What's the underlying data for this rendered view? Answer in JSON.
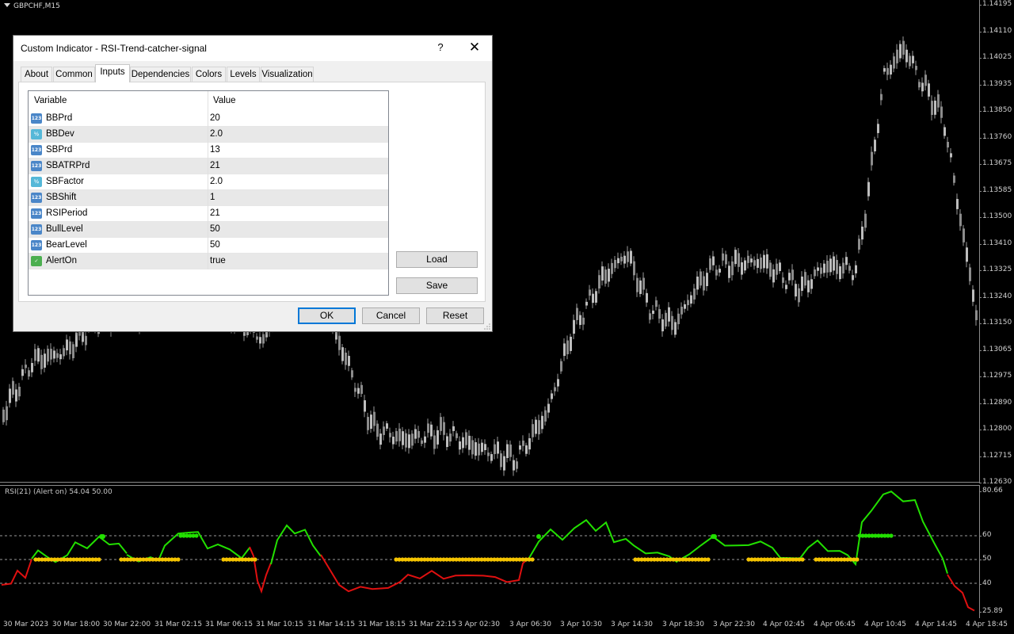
{
  "chart": {
    "symbol_label": "GBPCHF,M15",
    "rsi_label": "RSI(21) (Alert on) 54.04 50.00",
    "price_ticks": [
      "1.14195",
      "1.14110",
      "1.14025",
      "1.13935",
      "1.13850",
      "1.13760",
      "1.13675",
      "1.13585",
      "1.13500",
      "1.13410",
      "1.13325",
      "1.13240",
      "1.13150",
      "1.13065",
      "1.12975",
      "1.12890",
      "1.12800",
      "1.12715",
      "1.12630"
    ],
    "rsi_ticks": [
      "80.66",
      "60",
      "50",
      "40",
      "25.89"
    ],
    "time_ticks": [
      "30 Mar 2023",
      "30 Mar 18:00",
      "30 Mar 22:00",
      "31 Mar 02:15",
      "31 Mar 06:15",
      "31 Mar 10:15",
      "31 Mar 14:15",
      "31 Mar 18:15",
      "31 Mar 22:15",
      "3 Apr 02:30",
      "3 Apr 06:30",
      "3 Apr 10:30",
      "3 Apr 14:30",
      "3 Apr 18:30",
      "3 Apr 22:30",
      "4 Apr 02:45",
      "4 Apr 06:45",
      "4 Apr 10:45",
      "4 Apr 14:45",
      "4 Apr 18:45"
    ],
    "colors": {
      "bull": "#22e000",
      "bear": "#e01010",
      "signal": "#f5c400",
      "candle": "#9a9a9a"
    }
  },
  "dialog": {
    "title": "Custom Indicator - RSI-Trend-catcher-signal",
    "help_label": "?",
    "close_label": "✕",
    "tabs": [
      "About",
      "Common",
      "Inputs",
      "Dependencies",
      "Colors",
      "Levels",
      "Visualization"
    ],
    "active_tab": "Inputs",
    "grid": {
      "headers": {
        "variable": "Variable",
        "value": "Value"
      },
      "rows": [
        {
          "name": "BBPrd",
          "value": "20",
          "type": "int"
        },
        {
          "name": "BBDev",
          "value": "2.0",
          "type": "double"
        },
        {
          "name": "SBPrd",
          "value": "13",
          "type": "int"
        },
        {
          "name": "SBATRPrd",
          "value": "21",
          "type": "int"
        },
        {
          "name": "SBFactor",
          "value": "2.0",
          "type": "double"
        },
        {
          "name": "SBShift",
          "value": "1",
          "type": "int"
        },
        {
          "name": "RSIPeriod",
          "value": "21",
          "type": "int"
        },
        {
          "name": "BullLevel",
          "value": "50",
          "type": "int"
        },
        {
          "name": "BearLevel",
          "value": "50",
          "type": "int"
        },
        {
          "name": "AlertOn",
          "value": "true",
          "type": "bool"
        }
      ]
    },
    "buttons": {
      "load": "Load",
      "save": "Save",
      "ok": "OK",
      "cancel": "Cancel",
      "reset": "Reset"
    }
  }
}
